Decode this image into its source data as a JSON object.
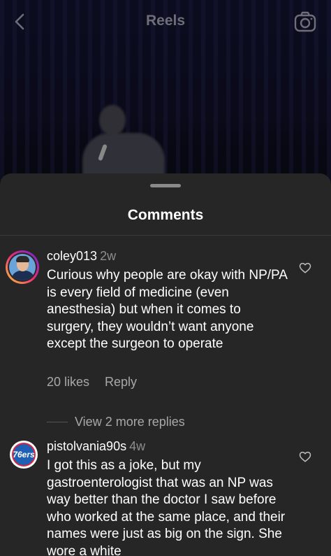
{
  "header": {
    "title": "Reels"
  },
  "sheet": {
    "title": "Comments"
  },
  "comments": [
    {
      "username": "coley013",
      "time": "2w",
      "text": "Curious why people are okay with NP/PA is every field of medicine (even anesthesia) but when it comes to surgery, they wouldn’t want anyone except the surgeon to operate",
      "likes": "20 likes",
      "reply": "Reply",
      "view_replies": "View 2 more replies"
    },
    {
      "username": "pistolvania90s",
      "time": "4w",
      "text": "I got this as a joke, but my gastroenterologist that was an NP was way better than the doctor I saw before who worked at the same place, and their names were just as big on the sign. She wore a white"
    }
  ],
  "badge_text": "76ers"
}
